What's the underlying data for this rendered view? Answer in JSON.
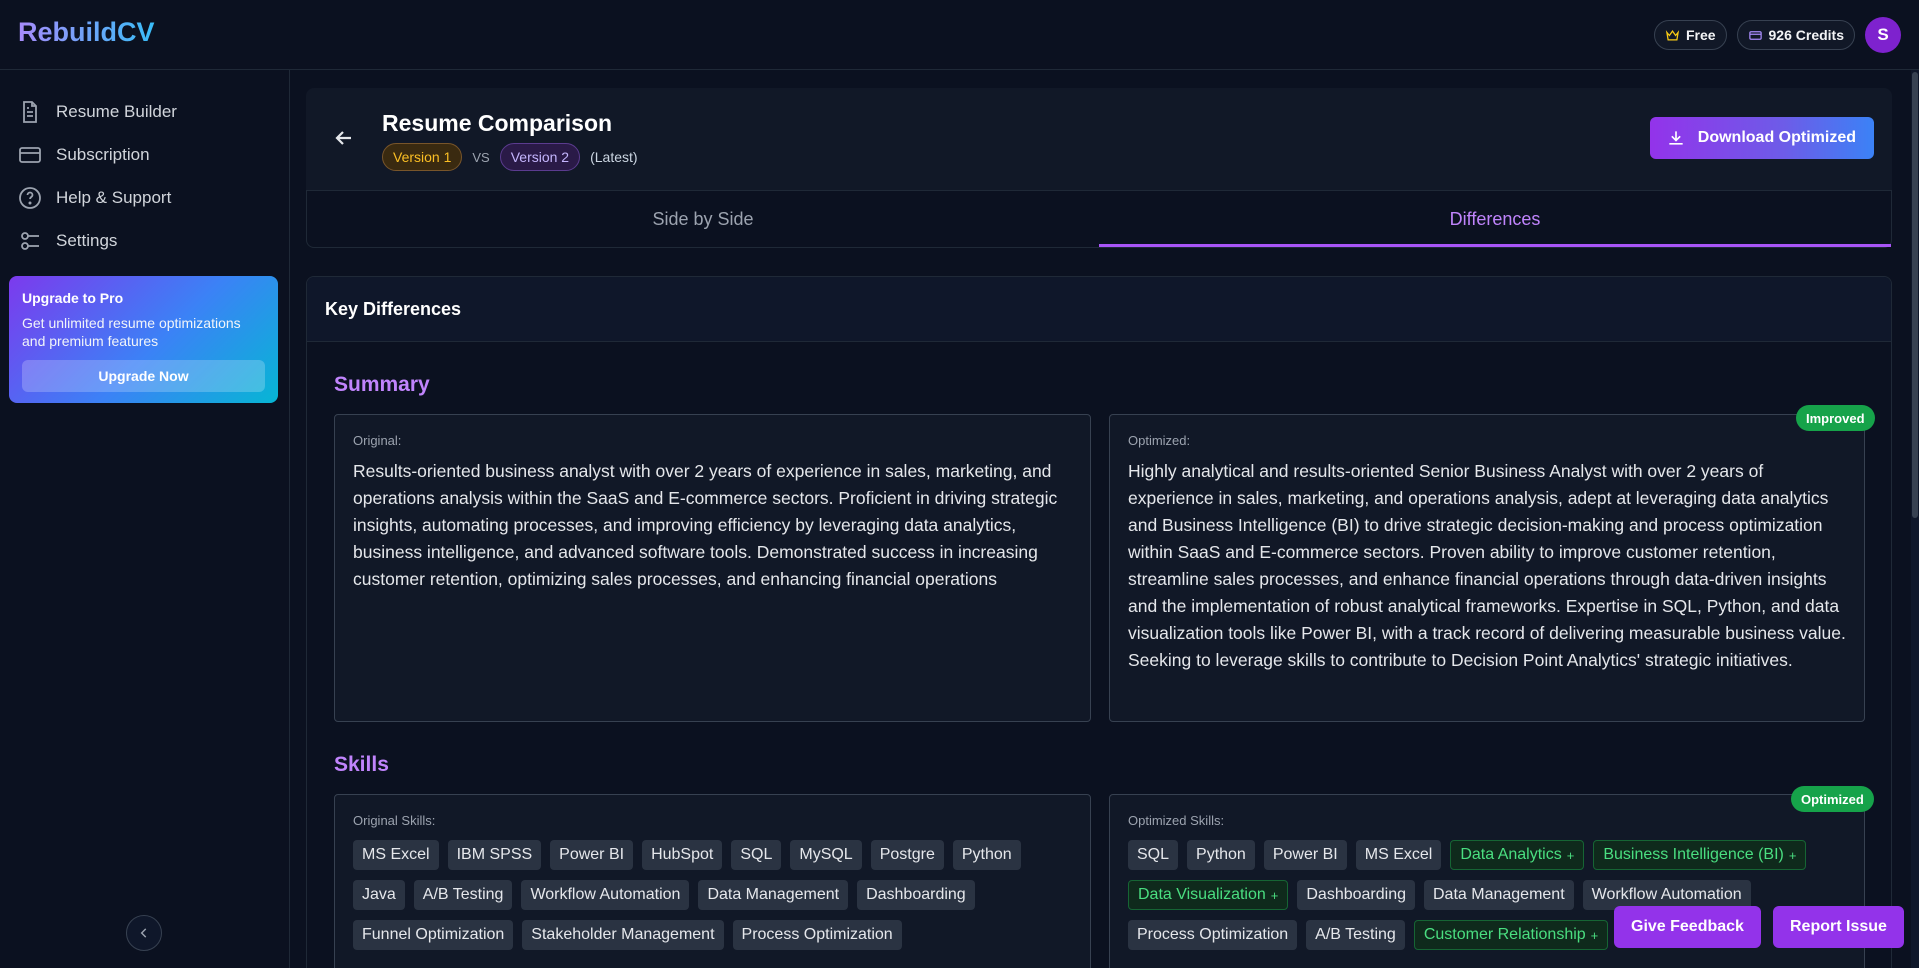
{
  "app": {
    "logo": "RebuildCV"
  },
  "topbar": {
    "plan_label": "Free",
    "credits_label": "926 Credits",
    "avatar_initial": "S"
  },
  "sidebar": {
    "items": [
      {
        "label": "Resume Builder",
        "icon": "document-icon"
      },
      {
        "label": "Subscription",
        "icon": "credit-card-icon"
      },
      {
        "label": "Help & Support",
        "icon": "help-circle-icon"
      },
      {
        "label": "Settings",
        "icon": "sliders-icon"
      }
    ],
    "upgrade": {
      "title": "Upgrade to Pro",
      "text": "Get unlimited resume optimizations and premium features",
      "button": "Upgrade Now"
    }
  },
  "header": {
    "title": "Resume Comparison",
    "version_a": "Version 1",
    "vs": "VS",
    "version_b": "Version 2",
    "latest": "(Latest)",
    "download_label": "Download Optimized"
  },
  "tabs": [
    {
      "label": "Side by Side",
      "active": false
    },
    {
      "label": "Differences",
      "active": true
    }
  ],
  "differences": {
    "heading": "Key Differences",
    "summary": {
      "title": "Summary",
      "original_label": "Original:",
      "original_text": "Results-oriented business analyst with over 2 years of experience in sales, marketing, and operations analysis within the SaaS and E-commerce sectors. Proficient in driving strategic insights, automating processes, and improving efficiency by leveraging data analytics, business intelligence, and advanced software tools. Demonstrated success in increasing customer retention, optimizing sales processes, and enhancing financial operations",
      "optimized_label": "Optimized:",
      "optimized_text": "Highly analytical and results-oriented Senior Business Analyst with over 2 years of experience in sales, marketing, and operations analysis, adept at leveraging data analytics and Business Intelligence (BI) to drive strategic decision-making and process optimization within SaaS and E-commerce sectors. Proven ability to improve customer retention, streamline sales processes, and enhance financial operations through data-driven insights and the implementation of robust analytical frameworks. Expertise in SQL, Python, and data visualization tools like Power BI, with a track record of delivering measurable business value. Seeking to leverage skills to contribute to Decision Point Analytics' strategic initiatives.",
      "badge": "Improved"
    },
    "skills": {
      "title": "Skills",
      "original_label": "Original Skills:",
      "original": [
        "MS Excel",
        "IBM SPSS",
        "Power BI",
        "HubSpot",
        "SQL",
        "MySQL",
        "Postgre",
        "Python",
        "Java",
        "A/B Testing",
        "Workflow Automation",
        "Data Management",
        "Dashboarding",
        "Funnel Optimization",
        "Stakeholder Management",
        "Process Optimization"
      ],
      "optimized_label": "Optimized Skills:",
      "optimized": [
        {
          "label": "SQL",
          "new": false
        },
        {
          "label": "Python",
          "new": false
        },
        {
          "label": "Power BI",
          "new": false
        },
        {
          "label": "MS Excel",
          "new": false
        },
        {
          "label": "Data Analytics",
          "new": true
        },
        {
          "label": "Business Intelligence (BI)",
          "new": true
        },
        {
          "label": "Data Visualization",
          "new": true
        },
        {
          "label": "Dashboarding",
          "new": false
        },
        {
          "label": "Data Management",
          "new": false
        },
        {
          "label": "Workflow Automation",
          "new": false
        },
        {
          "label": "Process Optimization",
          "new": false
        },
        {
          "label": "A/B Testing",
          "new": false
        },
        {
          "label": "Customer Relationship",
          "new": true
        }
      ],
      "new_marker": "+",
      "badge": "Optimized"
    }
  },
  "floating": {
    "feedback": "Give Feedback",
    "report": "Report Issue"
  },
  "colors": {
    "background": "#0b1120",
    "accent": "#a855f7",
    "success": "#16a34a"
  }
}
